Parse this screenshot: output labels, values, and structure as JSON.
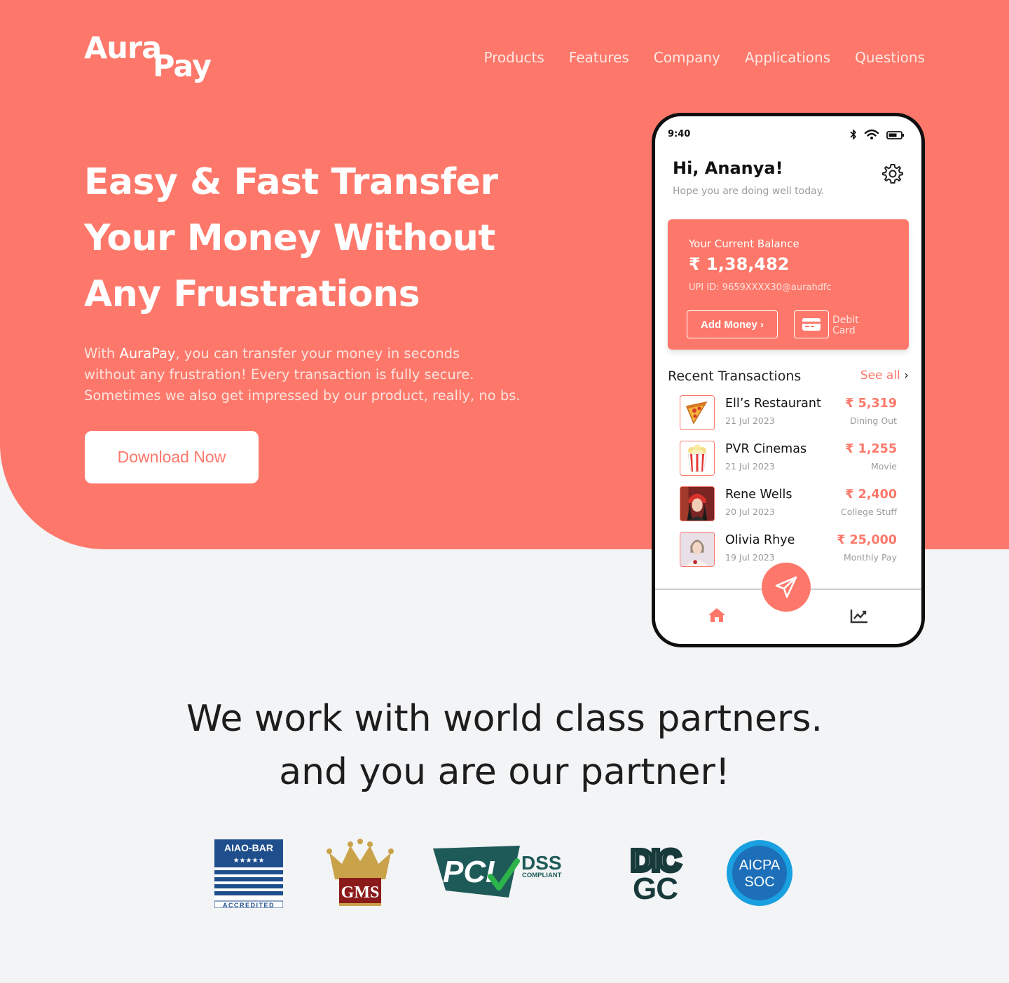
{
  "brand": {
    "line1": "Aura",
    "line2": "Pay"
  },
  "nav": {
    "items": [
      "Products",
      "Features",
      "Company",
      "Applications",
      "Questions"
    ]
  },
  "hero": {
    "headline": [
      "Easy & Fast Transfer",
      "Your Money Without",
      "Any Frustrations"
    ],
    "desc": {
      "prefix": "With ",
      "brand": "AuraPay",
      "line1_rest": ", you can transfer your money in seconds",
      "line2": "without any frustration! Every transaction is fully secure.",
      "line3": "Sometimes we also get impressed by our product, really, no bs."
    },
    "cta": "Download Now"
  },
  "phone": {
    "time": "9:40",
    "greeting": "Hi, Ananya!",
    "subtitle": "Hope you are doing well today.",
    "balance": {
      "label": "Your Current Balance",
      "amount": "₹ 1,38,482",
      "upi": "UPI ID: 9659XXXX30@aurahdfc",
      "add_money": "Add Money ›",
      "debit_line1": "Debit",
      "debit_line2": "Card"
    },
    "recent": {
      "title": "Recent Transactions",
      "see_all": "See all",
      "chevron": "›",
      "items": [
        {
          "name": "Ell’s Restaurant",
          "date": "21 Jul 2023",
          "amount": "₹ 5,319",
          "category": "Dining Out",
          "icon": "pizza-icon"
        },
        {
          "name": "PVR Cinemas",
          "date": "21 Jul 2023",
          "amount": "₹ 1,255",
          "category": "Movie",
          "icon": "popcorn-icon"
        },
        {
          "name": "Rene Wells",
          "date": "20 Jul 2023",
          "amount": "₹ 2,400",
          "category": "College Stuff",
          "icon": "avatar"
        },
        {
          "name": "Olivia Rhye",
          "date": "19 Jul 2023",
          "amount": "₹ 25,000",
          "category": "Monthly Pay",
          "icon": "avatar"
        }
      ]
    }
  },
  "partners": {
    "line1": "We work with world class partners.",
    "line2": "and you are our partner!",
    "logos": {
      "aiao": {
        "top": "AIAO-BAR",
        "stars": "★★★★★",
        "bottom": "ACCREDITED"
      },
      "gms": {
        "text": "GMS"
      },
      "pci": {
        "big": "PCI",
        "dss": "DSS",
        "compliant": "COMPLIANT"
      },
      "dicgc": {
        "top": "DIC",
        "bottom": "GC"
      },
      "aicpa": {
        "top": "AICPA",
        "bottom": "SOC"
      }
    }
  },
  "colors": {
    "accent": "#fd786a",
    "background": "#f3f4f6",
    "dark": "#1d1d1d"
  }
}
